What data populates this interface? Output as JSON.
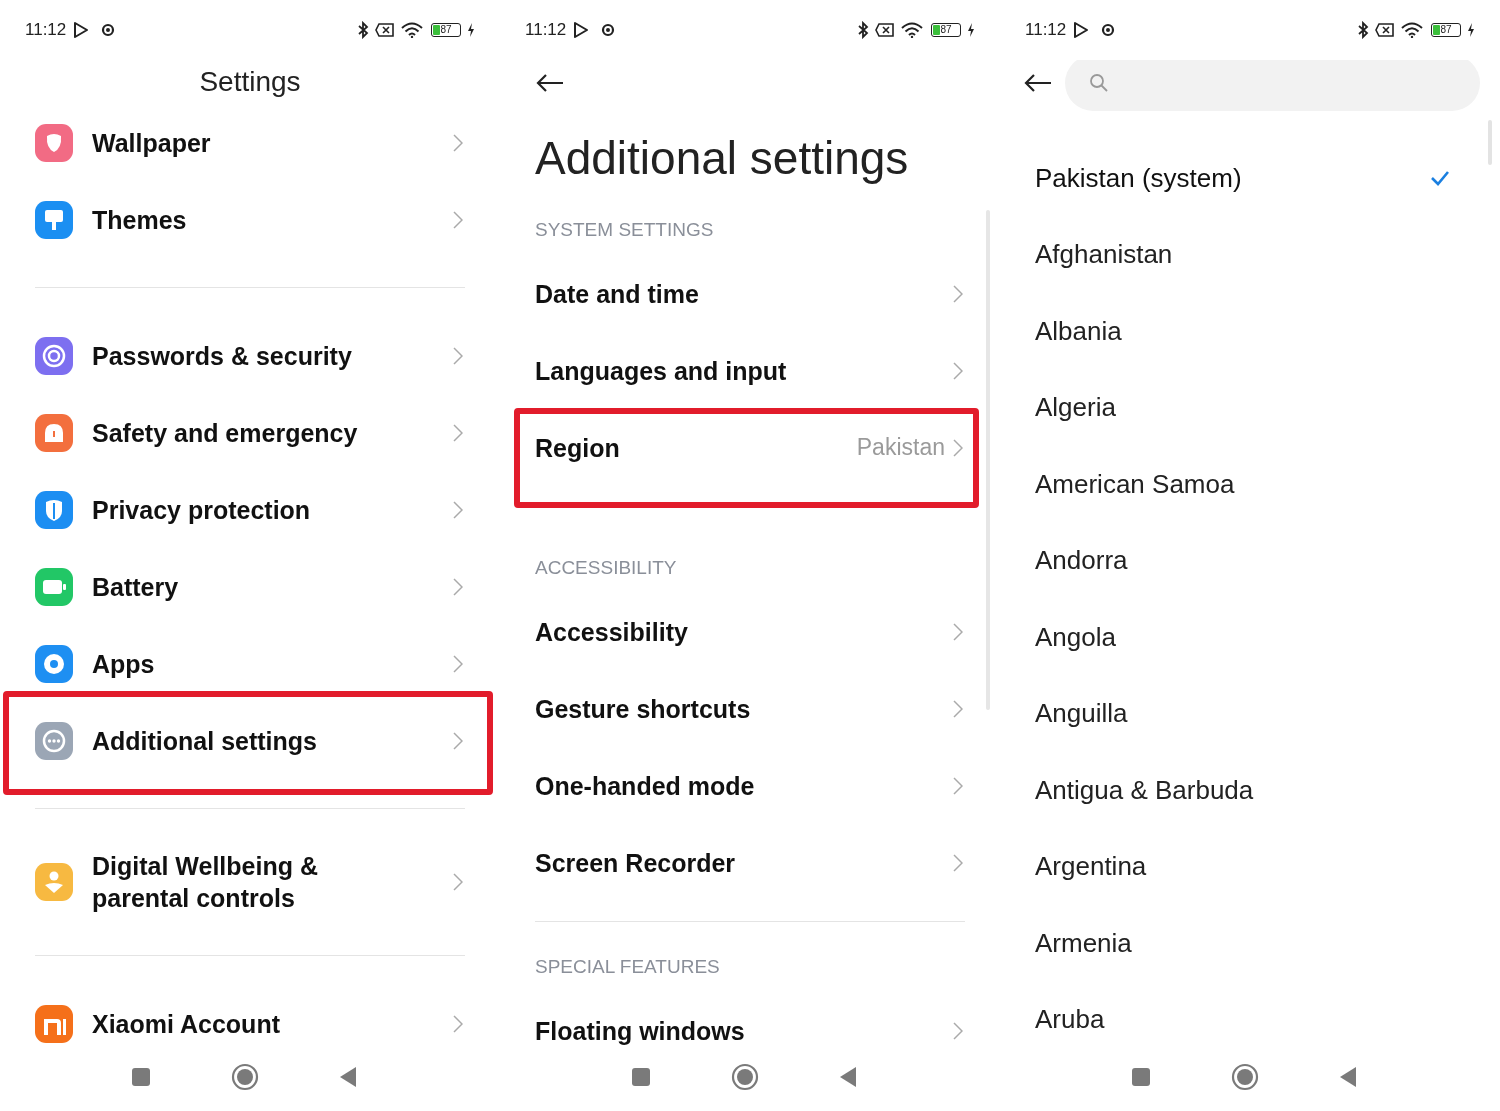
{
  "settings_screen": {
    "status_bar": {
      "time": "11:12",
      "battery": "87"
    },
    "title": "Settings",
    "groups": [
      {
        "items": [
          {
            "label": "Wallpaper",
            "color": "#f26b84",
            "highlighted": false
          },
          {
            "label": "Themes",
            "color": "#1b8ff2",
            "highlighted": false
          }
        ]
      },
      {
        "items": [
          {
            "label": "Passwords & security",
            "color": "#7d6ff0",
            "highlighted": false
          },
          {
            "label": "Safety and emergency",
            "color": "#f36f3e",
            "highlighted": false
          },
          {
            "label": "Privacy protection",
            "color": "#1c8ef2",
            "highlighted": false
          },
          {
            "label": "Battery",
            "color": "#22c766",
            "highlighted": false
          },
          {
            "label": "Apps",
            "color": "#1e8ff2",
            "highlighted": false
          },
          {
            "label": "Additional settings",
            "color": "#9ba6b5",
            "highlighted": true
          }
        ]
      },
      {
        "items": [
          {
            "label": "Digital Wellbeing & parental controls",
            "color": "#f7b941",
            "highlighted": false
          }
        ]
      },
      {
        "items": [
          {
            "label": "Xiaomi Account",
            "color": "#f5701a",
            "highlighted": false
          }
        ]
      }
    ]
  },
  "additional_settings_screen": {
    "status_bar": {
      "time": "11:12",
      "battery": "87"
    },
    "title": "Additional settings",
    "sections": [
      {
        "header": "SYSTEM SETTINGS",
        "divider": false,
        "items": [
          {
            "label": "Date and time",
            "highlighted": false
          },
          {
            "label": "Languages and input",
            "highlighted": false
          },
          {
            "label": "Region",
            "value": "Pakistan",
            "highlighted": true
          }
        ]
      },
      {
        "header": "ACCESSIBILITY",
        "divider": false,
        "items": [
          {
            "label": "Accessibility",
            "highlighted": false
          },
          {
            "label": "Gesture shortcuts",
            "highlighted": false
          },
          {
            "label": "One-handed mode",
            "highlighted": false
          },
          {
            "label": "Screen Recorder",
            "highlighted": false
          }
        ]
      },
      {
        "header": "SPECIAL FEATURES",
        "divider": true,
        "items": [
          {
            "label": "Floating windows",
            "highlighted": false
          }
        ]
      }
    ]
  },
  "region_screen": {
    "status_bar": {
      "time": "11:12",
      "battery": "87"
    },
    "countries": [
      {
        "name": "Pakistan (system)",
        "selected": true
      },
      {
        "name": "Afghanistan",
        "selected": false
      },
      {
        "name": "Albania",
        "selected": false
      },
      {
        "name": "Algeria",
        "selected": false
      },
      {
        "name": "American Samoa",
        "selected": false
      },
      {
        "name": "Andorra",
        "selected": false
      },
      {
        "name": "Angola",
        "selected": false
      },
      {
        "name": "Anguilla",
        "selected": false
      },
      {
        "name": "Antigua & Barbuda",
        "selected": false
      },
      {
        "name": "Argentina",
        "selected": false
      },
      {
        "name": "Armenia",
        "selected": false
      },
      {
        "name": "Aruba",
        "selected": false
      }
    ]
  }
}
